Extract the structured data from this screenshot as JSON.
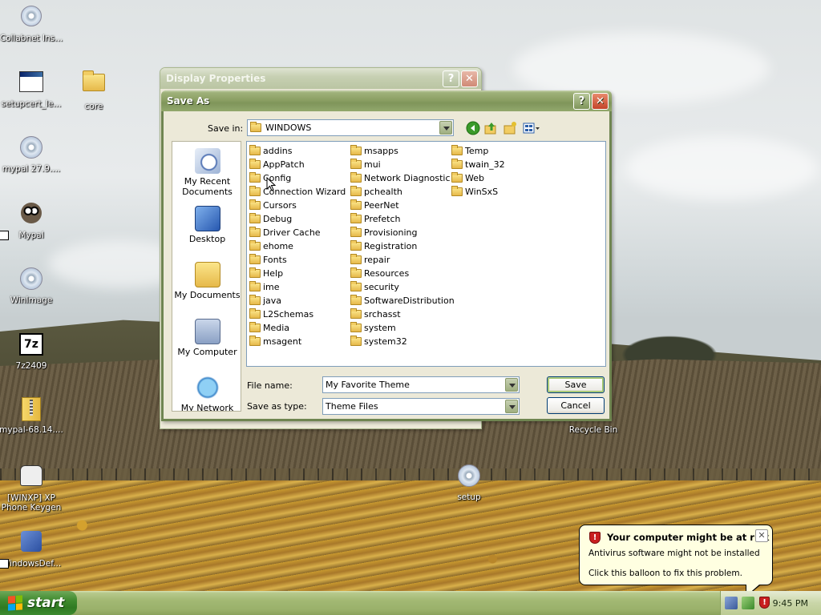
{
  "desktop": {
    "icons": [
      {
        "label": "Collabnet Ins..."
      },
      {
        "label": "setupcert_le..."
      },
      {
        "label": "core"
      },
      {
        "label": "mypal 27.9...."
      },
      {
        "label": "Mypal"
      },
      {
        "label": "WinImage"
      },
      {
        "label": "7z2409"
      },
      {
        "label": "mypal-68.14...."
      },
      {
        "label": "[WINXP] XP Phone Keygen"
      },
      {
        "label": "WindowsDef..."
      },
      {
        "label": "setup"
      },
      {
        "label": "Recycle Bin"
      }
    ]
  },
  "display_properties": {
    "title": "Display Properties",
    "help_glyph": "?",
    "close_glyph": "✕"
  },
  "save_as": {
    "title": "Save As",
    "help_glyph": "?",
    "close_glyph": "✕",
    "save_in_label": "Save in:",
    "save_in_value": "WINDOWS",
    "places": [
      {
        "label": "My Recent Documents",
        "icon": "recent-documents-icon"
      },
      {
        "label": "Desktop",
        "icon": "desktop-icon"
      },
      {
        "label": "My Documents",
        "icon": "my-documents-icon"
      },
      {
        "label": "My Computer",
        "icon": "my-computer-icon"
      },
      {
        "label": "My Network",
        "icon": "my-network-icon"
      }
    ],
    "folders_col1": [
      "addins",
      "AppPatch",
      "Config",
      "Connection Wizard",
      "Cursors",
      "Debug",
      "Driver Cache",
      "ehome",
      "Fonts",
      "Help",
      "ime",
      "java",
      "L2Schemas",
      "Media",
      "msagent"
    ],
    "folders_col2": [
      "msapps",
      "mui",
      "Network Diagnostic",
      "pchealth",
      "PeerNet",
      "Prefetch",
      "Provisioning",
      "Registration",
      "repair",
      "Resources",
      "security",
      "SoftwareDistribution",
      "srchasst",
      "system",
      "system32"
    ],
    "folders_col3": [
      "Temp",
      "twain_32",
      "Web",
      "WinSxS"
    ],
    "file_name_label": "File name:",
    "file_name_value": "My Favorite Theme",
    "save_as_type_label": "Save as type:",
    "save_as_type_value": "Theme Files",
    "save_button": "Save",
    "cancel_button": "Cancel"
  },
  "balloon": {
    "title": "Your computer might be at risk",
    "line1": "Antivirus software might not be installed",
    "line2": "Click this balloon to fix this problem.",
    "close_glyph": "✕"
  },
  "taskbar": {
    "start_label": "start",
    "clock": "9:45 PM"
  },
  "colors": {
    "title_bar": "#8ca064",
    "balloon_bg": "#ffffe1",
    "start_button": "#3f8a2e"
  }
}
